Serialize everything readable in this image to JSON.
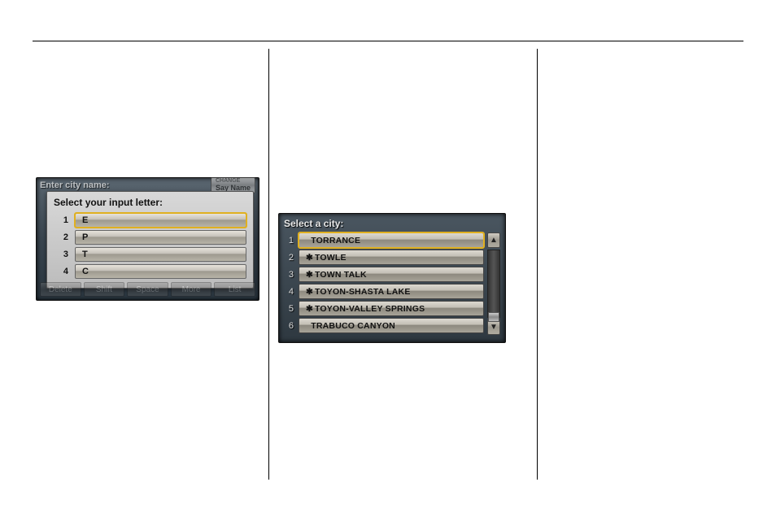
{
  "device1": {
    "header": "Enter city name:",
    "say_small": "CHANGE",
    "say": "Say Name",
    "popup_title": "Select your input letter:",
    "letters": [
      {
        "num": "1",
        "value": "E",
        "selected": true
      },
      {
        "num": "2",
        "value": "P",
        "selected": false
      },
      {
        "num": "3",
        "value": "T",
        "selected": false
      },
      {
        "num": "4",
        "value": "C",
        "selected": false
      }
    ],
    "bottom": [
      "Delete",
      "Shift",
      "Space",
      "More",
      "List"
    ]
  },
  "device2": {
    "title": "Select a city:",
    "cities": [
      {
        "num": "1",
        "name": "TORRANCE",
        "star": false,
        "selected": true
      },
      {
        "num": "2",
        "name": "TOWLE",
        "star": true,
        "selected": false
      },
      {
        "num": "3",
        "name": "TOWN TALK",
        "star": true,
        "selected": false
      },
      {
        "num": "4",
        "name": "TOYON-SHASTA LAKE",
        "star": true,
        "selected": false
      },
      {
        "num": "5",
        "name": "TOYON-VALLEY SPRINGS",
        "star": true,
        "selected": false
      },
      {
        "num": "6",
        "name": "TRABUCO CANYON",
        "star": false,
        "selected": false
      }
    ]
  },
  "glyphs": {
    "up": "▲",
    "down": "▼",
    "star": "✱"
  }
}
